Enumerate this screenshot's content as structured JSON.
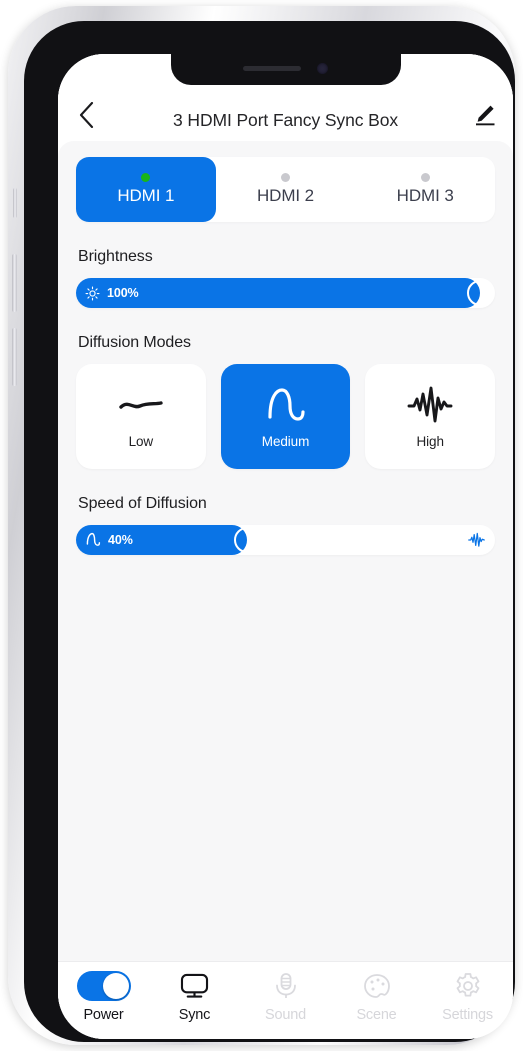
{
  "header": {
    "title": "3 HDMI Port Fancy Sync Box",
    "back_icon": "chevron-left-icon",
    "edit_icon": "pencil-edit-icon"
  },
  "hdmi_tabs": [
    {
      "label": "HDMI 1",
      "active": true,
      "status": "connected"
    },
    {
      "label": "HDMI 2",
      "active": false,
      "status": "idle"
    },
    {
      "label": "HDMI 3",
      "active": false,
      "status": "idle"
    }
  ],
  "brightness": {
    "title": "Brightness",
    "value_label": "100%",
    "percent": 100,
    "icon": "sun-brightness-icon"
  },
  "diffusion": {
    "title": "Diffusion Modes",
    "modes": [
      {
        "label": "Low",
        "icon": "flat-wave-icon",
        "active": false
      },
      {
        "label": "Medium",
        "icon": "sine-wave-icon",
        "active": true
      },
      {
        "label": "High",
        "icon": "spiky-wave-icon",
        "active": false
      }
    ]
  },
  "speed": {
    "title": "Speed of Diffusion",
    "value_label": "40%",
    "percent": 40,
    "icon": "sine-wave-icon",
    "end_icon": "waveform-icon"
  },
  "bottom_nav": [
    {
      "label": "Power",
      "icon": "toggle-switch-on-icon",
      "enabled": true,
      "state": "on"
    },
    {
      "label": "Sync",
      "icon": "monitor-icon",
      "enabled": true
    },
    {
      "label": "Sound",
      "icon": "microphone-icon",
      "enabled": false
    },
    {
      "label": "Scene",
      "icon": "palette-icon",
      "enabled": false
    },
    {
      "label": "Settings",
      "icon": "gear-icon",
      "enabled": false
    }
  ],
  "colors": {
    "accent_blue": "#0a74e6",
    "status_green": "#19b619",
    "inactive_dot": "#c9c9ce",
    "disabled_text": "#d6d6da",
    "content_bg": "#f7f7f8"
  }
}
